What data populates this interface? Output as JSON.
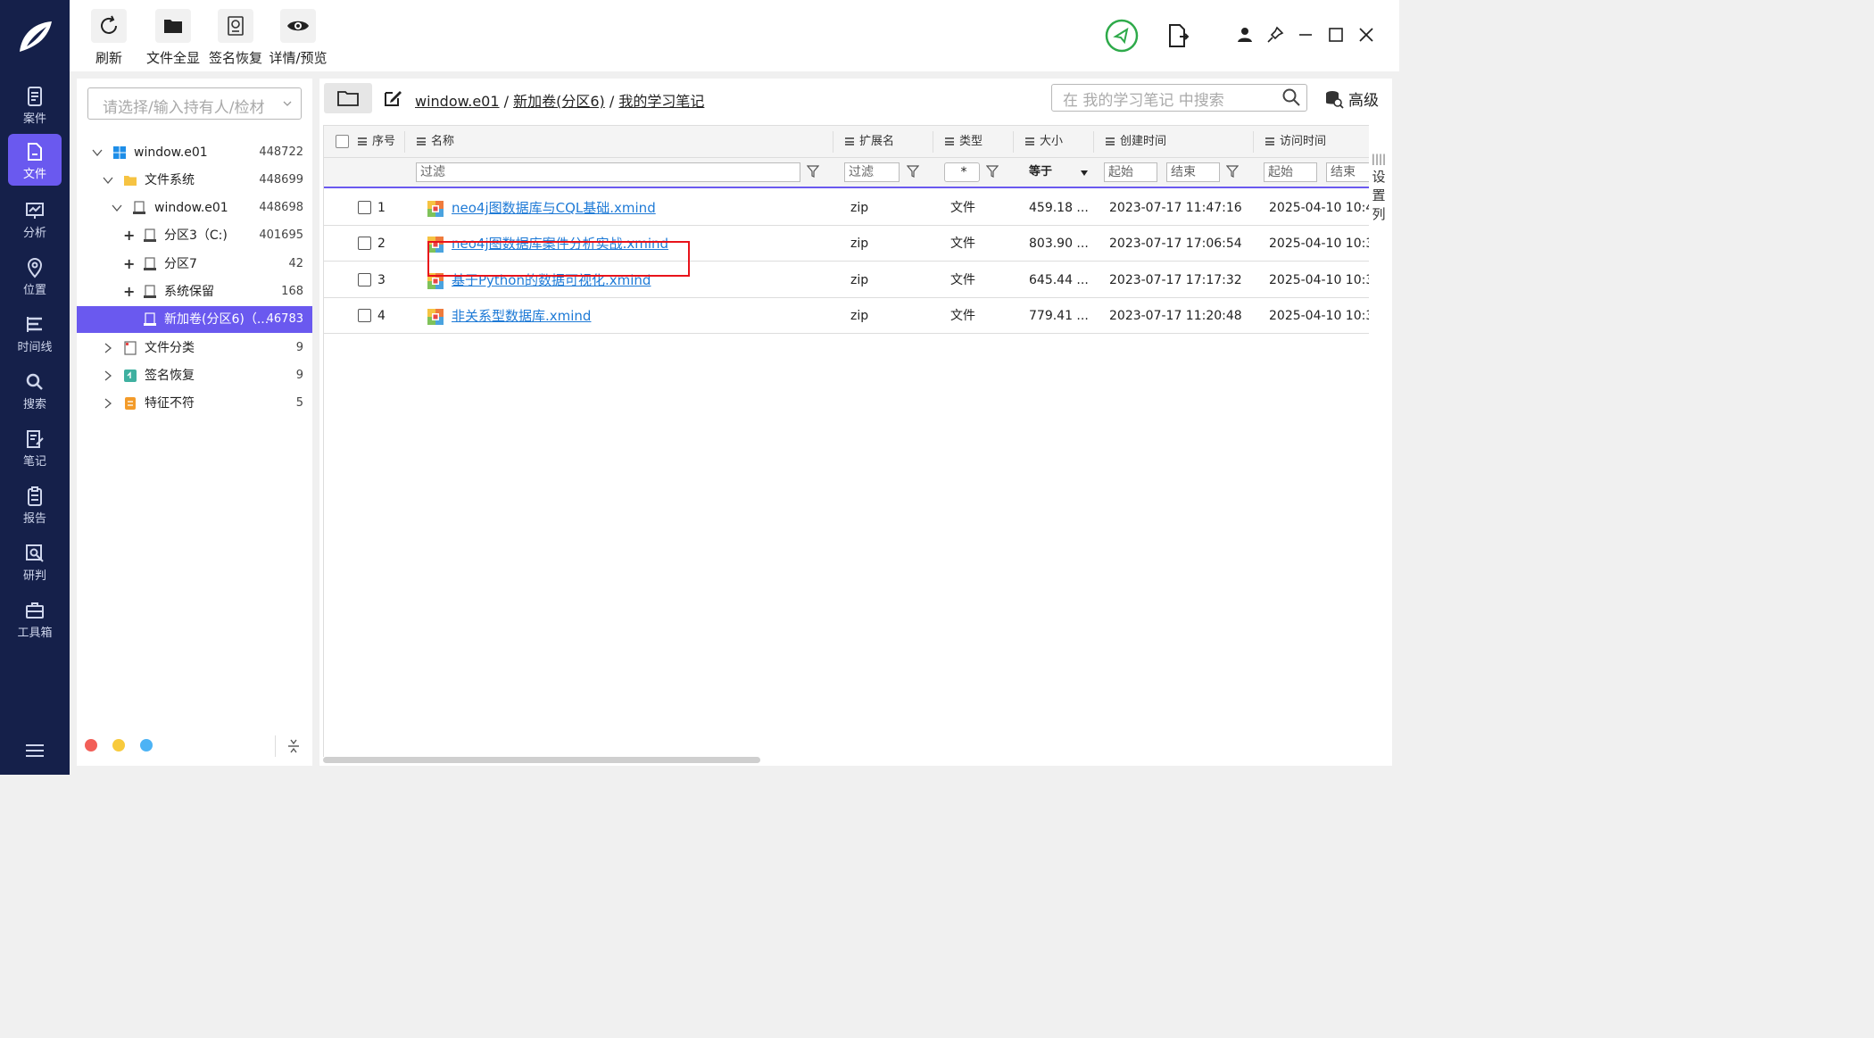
{
  "nav": {
    "items": [
      {
        "label": "案件",
        "icon": "case-icon"
      },
      {
        "label": "文件",
        "icon": "file-icon",
        "active": true
      },
      {
        "label": "分析",
        "icon": "analysis-icon"
      },
      {
        "label": "位置",
        "icon": "location-icon"
      },
      {
        "label": "时间线",
        "icon": "timeline-icon"
      },
      {
        "label": "搜索",
        "icon": "search-icon"
      },
      {
        "label": "笔记",
        "icon": "note-icon"
      },
      {
        "label": "报告",
        "icon": "report-icon"
      },
      {
        "label": "研判",
        "icon": "judge-icon"
      },
      {
        "label": "工具箱",
        "icon": "toolbox-icon"
      }
    ]
  },
  "toolbar": {
    "refresh": "刷新",
    "show_all": "文件全显",
    "signature_recover": "签名恢复",
    "detail_preview": "详情/预览"
  },
  "tree": {
    "search_placeholder": "请选择/输入持有人/检材",
    "nodes": [
      {
        "label": "window.e01",
        "count": "448722"
      },
      {
        "label": "文件系统",
        "count": "448699"
      },
      {
        "label": "window.e01",
        "count": "448698"
      },
      {
        "label": "分区3（C:)",
        "count": "401695"
      },
      {
        "label": "分区7",
        "count": "42"
      },
      {
        "label": "系统保留",
        "count": "168"
      },
      {
        "label": "新加卷(分区6)（...",
        "count": "46783"
      },
      {
        "label": "文件分类",
        "count": "9"
      },
      {
        "label": "签名恢复",
        "count": "9"
      },
      {
        "label": "特征不符",
        "count": "5"
      }
    ]
  },
  "breadcrumb": {
    "parts": [
      "window.e01",
      "新加卷(分区6)",
      "我的学习笔记"
    ],
    "sep": "/"
  },
  "main": {
    "search_placeholder": "在 我的学习笔记 中搜索",
    "advanced": "高级",
    "set_columns": "设置列"
  },
  "table": {
    "columns": [
      "序号",
      "名称",
      "扩展名",
      "类型",
      "大小",
      "创建时间",
      "访问时间"
    ],
    "filter": {
      "name": "过滤",
      "ext": "过滤",
      "type": "*",
      "size": "等于",
      "created_start": "起始",
      "created_end": "结束",
      "access_start": "起始",
      "access_end": "结束"
    },
    "rows": [
      {
        "no": "1",
        "name": "neo4j图数据库与CQL基础.xmind",
        "ext": "zip",
        "type": "文件",
        "size": "459.18 ...",
        "created": "2023-07-17 11:47:16",
        "accessed": "2025-04-10 10:4"
      },
      {
        "no": "2",
        "name": "neo4j图数据库案件分析实战.xmind",
        "ext": "zip",
        "type": "文件",
        "size": "803.90 ...",
        "created": "2023-07-17 17:06:54",
        "accessed": "2025-04-10 10:3"
      },
      {
        "no": "3",
        "name": "基于Python的数据可视化.xmind",
        "ext": "zip",
        "type": "文件",
        "size": "645.44 ...",
        "created": "2023-07-17 17:17:32",
        "accessed": "2025-04-10 10:3"
      },
      {
        "no": "4",
        "name": "非关系型数据库.xmind",
        "ext": "zip",
        "type": "文件",
        "size": "779.41 ...",
        "created": "2023-07-17 11:20:48",
        "accessed": "2025-04-10 10:3"
      }
    ]
  },
  "colors": {
    "nav_bg": "#15204a",
    "accent": "#6a59ef",
    "link": "#1e7ad6",
    "highlight": "#e8131b"
  }
}
